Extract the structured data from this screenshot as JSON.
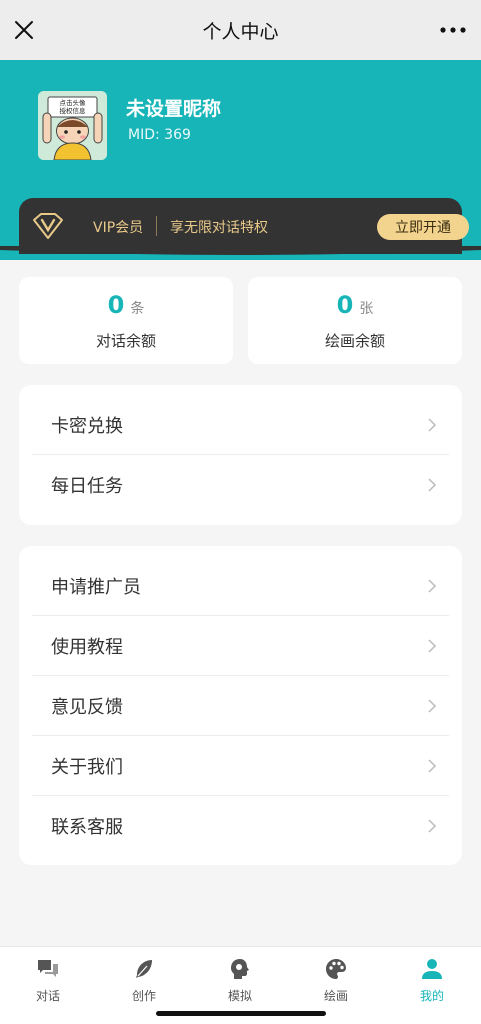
{
  "nav": {
    "title": "个人中心"
  },
  "profile": {
    "nickname": "未设置昵称",
    "mid": "MID: 369",
    "avatar_text_line1": "点击头像",
    "avatar_text_line2": "授权信息"
  },
  "vip": {
    "label": "VIP会员",
    "desc": "享无限对话特权",
    "button": "立即开通"
  },
  "balances": [
    {
      "value": "0",
      "unit": "条",
      "label": "对话余额"
    },
    {
      "value": "0",
      "unit": "张",
      "label": "绘画余额"
    }
  ],
  "menu_group_1": [
    {
      "label": "卡密兑换"
    },
    {
      "label": "每日任务"
    }
  ],
  "menu_group_2": [
    {
      "label": "申请推广员"
    },
    {
      "label": "使用教程"
    },
    {
      "label": "意见反馈"
    },
    {
      "label": "关于我们"
    },
    {
      "label": "联系客服"
    }
  ],
  "tabs": [
    {
      "label": "对话",
      "icon": "chat-icon"
    },
    {
      "label": "创作",
      "icon": "feather-icon"
    },
    {
      "label": "模拟",
      "icon": "head-icon"
    },
    {
      "label": "绘画",
      "icon": "palette-icon"
    },
    {
      "label": "我的",
      "icon": "user-icon",
      "active": true
    }
  ],
  "colors": {
    "accent": "#17b5b8",
    "vip_bg": "#333333",
    "vip_gold": "#e8c98a",
    "vip_button": "#f3d48e"
  }
}
